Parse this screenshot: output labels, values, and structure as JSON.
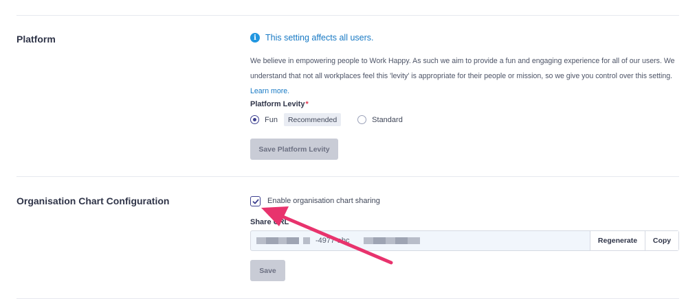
{
  "platform": {
    "title": "Platform",
    "info": "This setting affects all users.",
    "description": "We believe in empowering people to Work Happy. As such we aim to provide a fun and engaging experience for all of our users. We understand that not all workplaces feel this 'levity' is appropriate for their people or mission, so we give you control over this setting.",
    "learn_more": "Learn more.",
    "levity_label": "Platform Levity",
    "required_mark": "*",
    "options": [
      {
        "label": "Fun",
        "badge": "Recommended",
        "checked": true
      },
      {
        "label": "Standard",
        "checked": false
      }
    ],
    "save_label": "Save Platform Levity"
  },
  "org_chart": {
    "title": "Organisation Chart Configuration",
    "enable_label": "Enable organisation chart sharing",
    "enabled": true,
    "share_url_label": "Share URL",
    "share_url_visible": "-4977-abc",
    "regenerate_label": "Regenerate",
    "copy_label": "Copy",
    "save_label": "Save"
  },
  "colors": {
    "accent": "#3c3f8f",
    "info": "#2196e0",
    "link": "#1779c4",
    "annotation_arrow": "#e8336d"
  },
  "icons": [
    "info-icon",
    "check-icon",
    "annotation-arrow"
  ]
}
